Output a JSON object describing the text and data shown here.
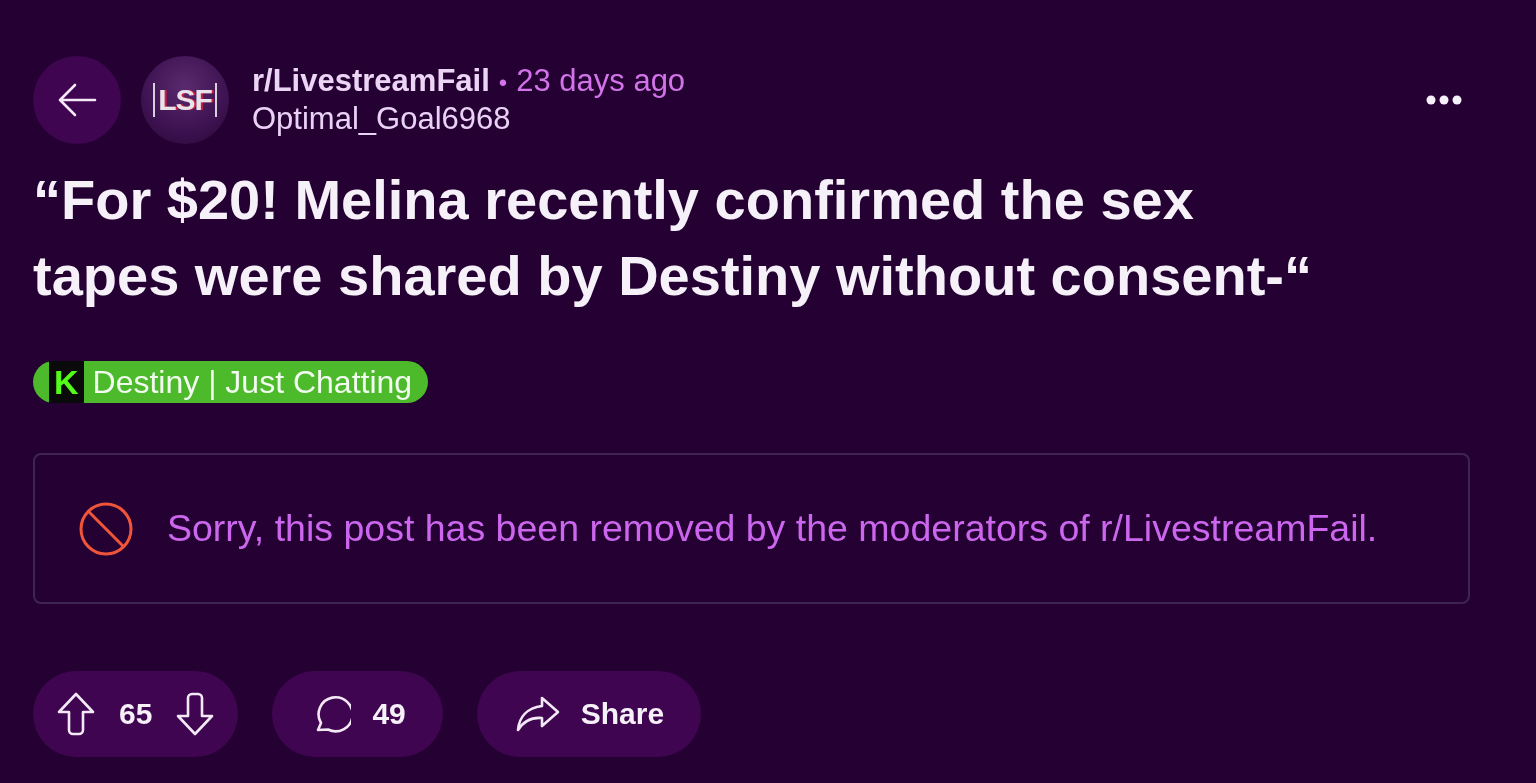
{
  "post_header": {
    "avatar_text": "LSF",
    "subreddit": "r/LivestreamFail",
    "separator": "•",
    "time": "23 days ago",
    "author": "Optimal_Goal6968"
  },
  "title": "“For $20! Melina recently confirmed the sex tapes were shared by Destiny without consent-“",
  "flair": {
    "logo_text": "K",
    "text": "Destiny | Just Chatting"
  },
  "removed_notice": {
    "message": "Sorry, this post has been removed by the moderators of r/LivestreamFail."
  },
  "actions": [
    {
      "kind": "vote",
      "count": "65"
    },
    {
      "kind": "comments",
      "count": "49"
    },
    {
      "kind": "share",
      "label": "Share"
    }
  ]
}
